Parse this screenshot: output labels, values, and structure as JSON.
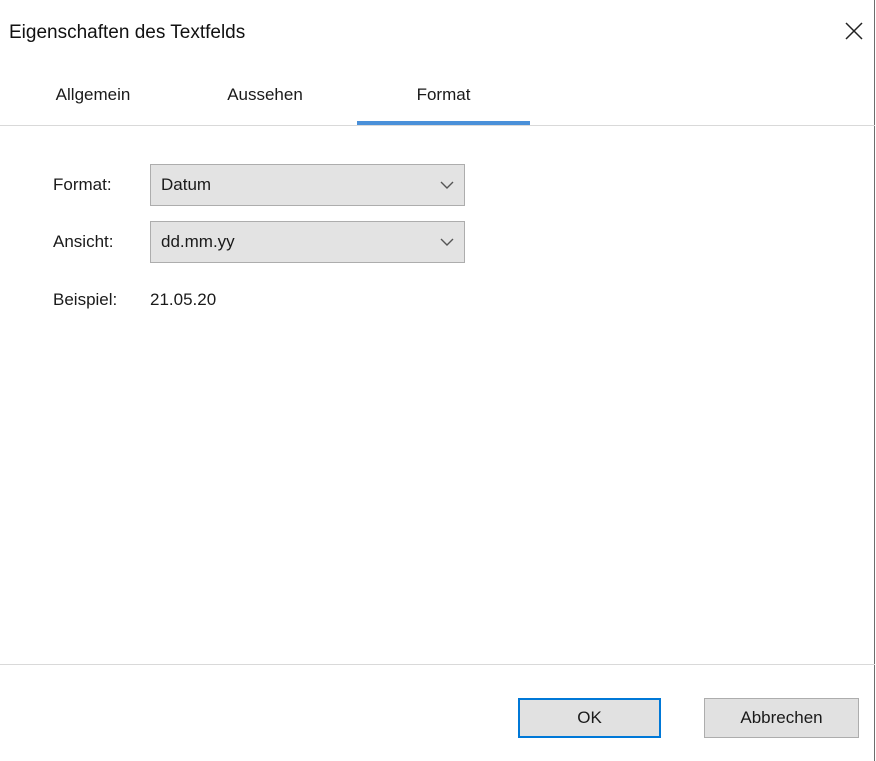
{
  "window": {
    "title": "Eigenschaften des Textfelds",
    "close_icon": "close-icon"
  },
  "tabs": [
    {
      "label": "Allgemein",
      "active": false
    },
    {
      "label": "Aussehen",
      "active": false
    },
    {
      "label": "Format",
      "active": true
    }
  ],
  "form": {
    "format_label": "Format:",
    "format_value": "Datum",
    "view_label": "Ansicht:",
    "view_value": "dd.mm.yy",
    "example_label": "Beispiel:",
    "example_value": "21.05.20",
    "dropdown_icon": "chevron-down-icon"
  },
  "buttons": {
    "ok_label": "OK",
    "cancel_label": "Abbrechen"
  },
  "colors": {
    "accent": "#4a90d9",
    "focus_border": "#0078d7",
    "control_background": "#e3e3e3",
    "button_background": "#e1e1e1"
  }
}
